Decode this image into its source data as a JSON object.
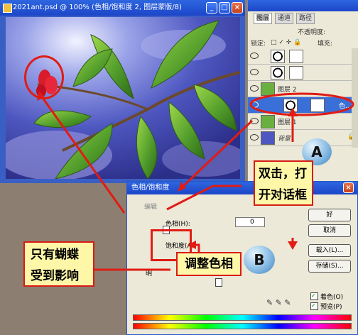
{
  "document": {
    "title": "2021ant.psd @ 100% (色相/饱和度 2, 图层蒙版/8)",
    "window_buttons": [
      "_",
      "□",
      "×"
    ]
  },
  "layers_panel": {
    "tabs": [
      "图层",
      "通道",
      "路径"
    ],
    "opacity_label": "不透明度:",
    "lock_label": "锁定:",
    "fill_label": "填充:",
    "layers": [
      {
        "name": "",
        "type": "adjustment"
      },
      {
        "name": "",
        "type": "adjustment"
      },
      {
        "name": "图层 2",
        "type": "image"
      },
      {
        "name": "色...",
        "type": "adjustment-selected"
      },
      {
        "name": "图层 1",
        "type": "image"
      },
      {
        "name": "背景",
        "type": "background"
      }
    ]
  },
  "dialog": {
    "title": "色相/饱和度",
    "edit_label": "编辑",
    "hue_label": "色相(H):",
    "hue_value": "0",
    "saturation_label": "饱和度(A):",
    "lightness_label": "明",
    "buttons": [
      "好",
      "取消",
      "载入(L)...",
      "存储(S)..."
    ],
    "colorize_label": "着色(O)",
    "preview_label": "预览(P)"
  },
  "annotations": {
    "callout_double_click": "双击，打开对话框",
    "callout_adjust_hue": "调整色相",
    "callout_only_butterfly": "只有蝴蝶受到影响",
    "marker_a": "A",
    "marker_b": "B"
  },
  "colors": {
    "annotation_red": "#d81c14",
    "callout_yellow": "#fff7a8",
    "sky_blue": "#4e5fc0",
    "titlebar_blue": "#1c46c8"
  }
}
